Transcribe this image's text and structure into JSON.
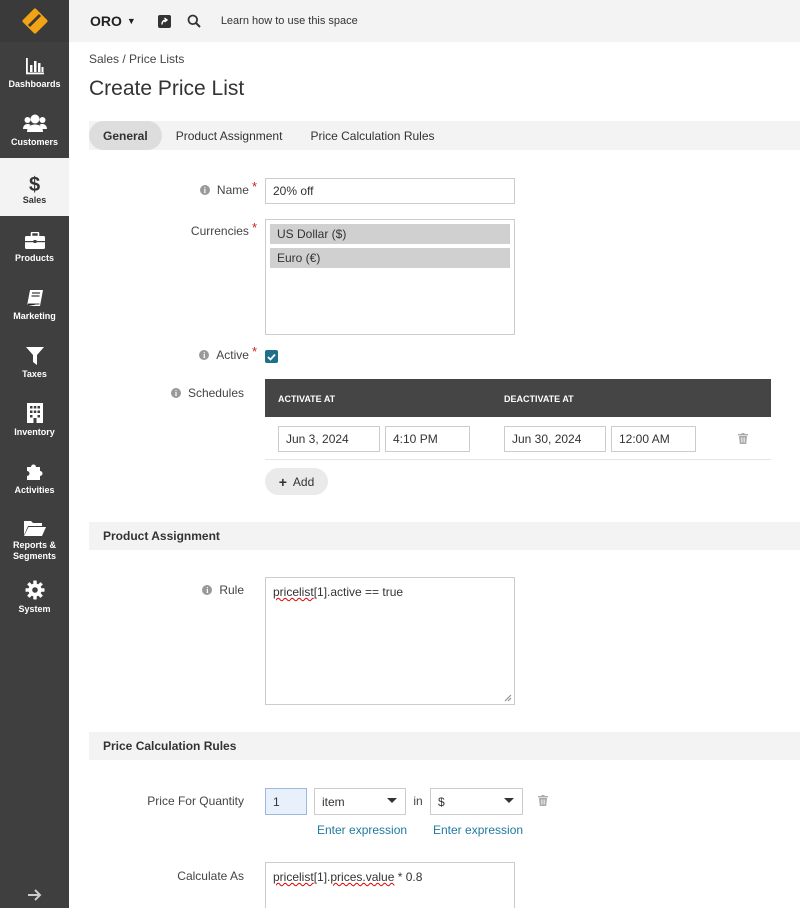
{
  "app": {
    "org_name": "ORO",
    "learn_text": "Learn how to use this space"
  },
  "sidebar": {
    "items": [
      {
        "label": "Dashboards",
        "icon": "bar-chart-icon"
      },
      {
        "label": "Customers",
        "icon": "users-icon"
      },
      {
        "label": "Sales",
        "icon": "dollar-icon"
      },
      {
        "label": "Products",
        "icon": "briefcase-icon"
      },
      {
        "label": "Marketing",
        "icon": "book-icon"
      },
      {
        "label": "Taxes",
        "icon": "filter-icon"
      },
      {
        "label": "Inventory",
        "icon": "building-icon"
      },
      {
        "label": "Activities",
        "icon": "puzzle-icon"
      },
      {
        "label": "Reports & Segments",
        "icon": "folder-icon"
      },
      {
        "label": "System",
        "icon": "gear-icon"
      }
    ],
    "active": "Sales"
  },
  "breadcrumb": {
    "part1": "Sales",
    "sep": " / ",
    "part2": "Price Lists"
  },
  "page_title": "Create Price List",
  "tabs": [
    "General",
    "Product Assignment",
    "Price Calculation Rules"
  ],
  "form": {
    "name_label": "Name",
    "name_value": "20% off",
    "currencies_label": "Currencies",
    "currencies": [
      "US Dollar ($)",
      "Euro (€)"
    ],
    "active_label": "Active",
    "active_checked": true,
    "schedules_label": "Schedules",
    "schedule_headers": {
      "activate": "ACTIVATE AT",
      "deactivate": "DEACTIVATE AT"
    },
    "schedule": {
      "activate_date": "Jun 3, 2024",
      "activate_time": "4:10 PM",
      "deactivate_date": "Jun 30, 2024",
      "deactivate_time": "12:00 AM"
    },
    "add_label": "Add"
  },
  "product_assignment": {
    "section_title": "Product Assignment",
    "rule_label": "Rule",
    "rule_word": "pricelist",
    "rule_rest": "[1].active == true"
  },
  "price_calculation": {
    "section_title": "Price Calculation Rules",
    "pfq_label": "Price For Quantity",
    "quantity": "1",
    "unit": "item",
    "in_label": "in",
    "currency": "$",
    "enter_expression_1": "Enter expression",
    "enter_expression_2": "Enter expression",
    "calc_label": "Calculate As",
    "calc_word1": "pricelist",
    "calc_mid": "[1].",
    "calc_word2": "prices.value",
    "calc_rest": " * 0.8"
  }
}
